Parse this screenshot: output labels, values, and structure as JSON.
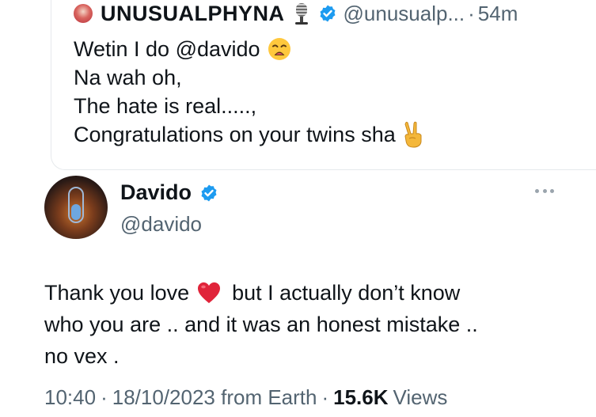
{
  "quoted_tweet": {
    "display_name": "UNUSUALPHYNA",
    "handle": "@unusualp...",
    "separator": "·",
    "time_ago": "54m",
    "lines": [
      "Wetin I do @davido",
      "Na wah oh,",
      "The hate is real.....,",
      "Congratulations on your twins sha"
    ],
    "icons": [
      "avatar",
      "microphone-icon",
      "verified-icon",
      "weary-face-emoji",
      "victory-hand-emoji"
    ]
  },
  "tweet": {
    "display_name": "Davido",
    "handle": "@davido",
    "text_line1_before": "Thank you love",
    "text_line1_after": "but  I actually don’t know",
    "text_line2": "who you are .. and it was an honest mistake ..",
    "text_line3": "no vex .",
    "time": "10:40",
    "separator": "·",
    "date": "18/10/2023 from Earth",
    "views_count": "15.6K",
    "views_label": "Views",
    "icons": [
      "avatar",
      "verified-icon",
      "more-icon",
      "red-heart-emoji"
    ]
  },
  "colors": {
    "verified_blue": "#1d9bf0",
    "secondary_text": "#536471",
    "primary_text": "#0f1419",
    "heart_red": "#e0243a"
  }
}
